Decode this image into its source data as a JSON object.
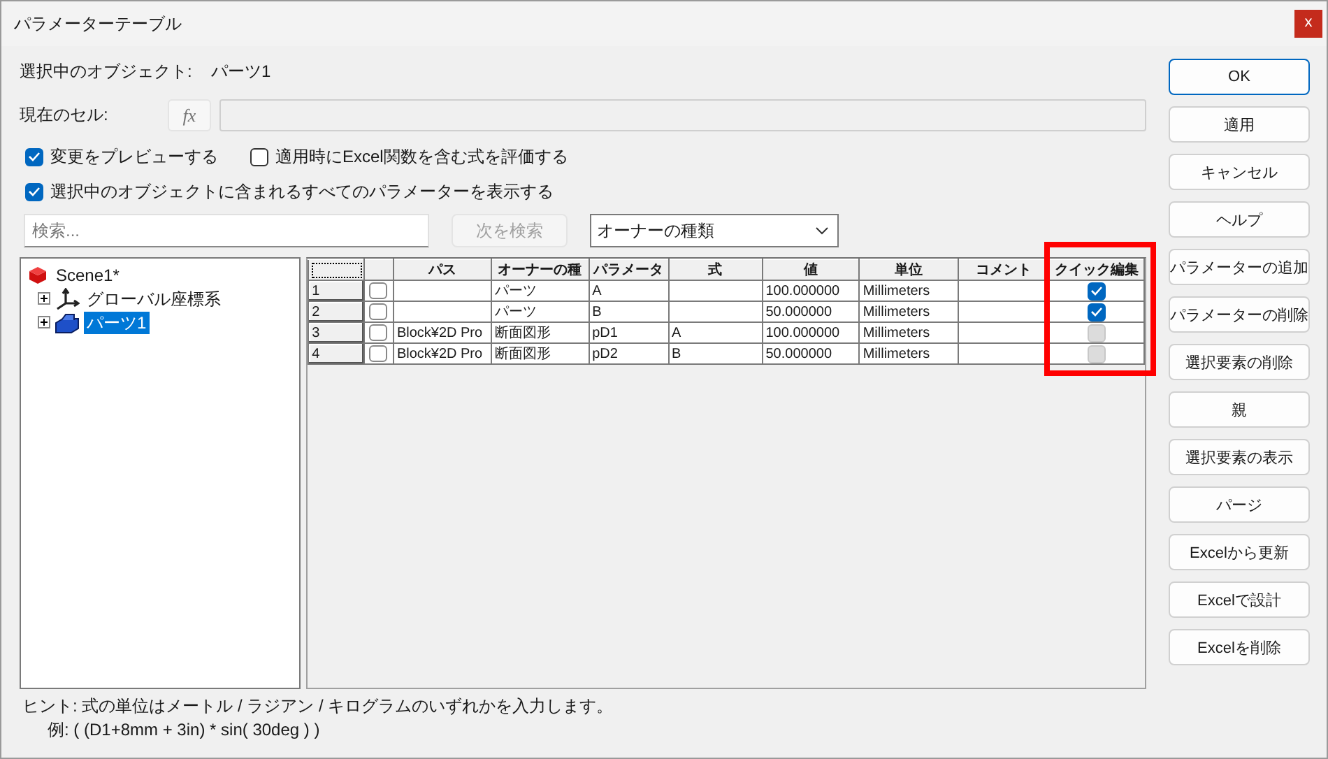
{
  "window": {
    "title": "パラメーターテーブル",
    "close": "x"
  },
  "selected_object": {
    "label": "選択中のオブジェクト:",
    "value": "パーツ1"
  },
  "current_cell": {
    "label": "現在のセル:",
    "fx": "fx"
  },
  "options": [
    {
      "label": "変更をプレビューする",
      "checked": true
    },
    {
      "label": "適用時にExcel関数を含む式を評価する",
      "checked": false
    },
    {
      "label": "選択中のオブジェクトに含まれるすべてのパラメーターを表示する",
      "checked": true
    }
  ],
  "search": {
    "placeholder": "検索...",
    "find_next": {
      "label": "次を検索",
      "disabled": true
    },
    "filter": "オーナーの種類"
  },
  "tree": [
    {
      "label": "Scene1*",
      "kind": "scene",
      "selected": false,
      "children": [
        {
          "label": "グローバル座標系",
          "kind": "axes",
          "selected": false,
          "expanded": false
        },
        {
          "label": "パーツ1",
          "kind": "part",
          "selected": true,
          "expanded": false
        }
      ]
    }
  ],
  "table": {
    "columns": [
      "パス",
      "オーナーの種",
      "パラメータ",
      "式",
      "値",
      "単位",
      "コメント",
      "クイック編集"
    ],
    "rows": [
      {
        "number": "1",
        "checked": false,
        "cells": [
          "",
          "パーツ",
          "A",
          "",
          "100.000000",
          "Millimeters",
          ""
        ],
        "quick_edit": true,
        "quick_edit_disabled": false
      },
      {
        "number": "2",
        "checked": false,
        "cells": [
          "",
          "パーツ",
          "B",
          "",
          "50.000000",
          "Millimeters",
          ""
        ],
        "quick_edit": true,
        "quick_edit_disabled": false
      },
      {
        "number": "3",
        "checked": false,
        "cells": [
          "Block¥2D Pro",
          "断面図形",
          "pD1",
          "A",
          "100.000000",
          "Millimeters",
          ""
        ],
        "quick_edit": false,
        "quick_edit_disabled": true
      },
      {
        "number": "4",
        "checked": false,
        "cells": [
          "Block¥2D Pro",
          "断面図形",
          "pD2",
          "B",
          "50.000000",
          "Millimeters",
          ""
        ],
        "quick_edit": false,
        "quick_edit_disabled": true
      }
    ]
  },
  "hint": [
    "ヒント: 式の単位はメートル / ラジアン / キログラムのいずれかを入力します。",
    "例: ( (D1+8mm + 3in) * sin( 30deg ) )"
  ],
  "buttons": [
    {
      "label": "OK",
      "default": true
    },
    {
      "label": "適用",
      "default": false
    },
    {
      "label": "キャンセル",
      "default": false
    },
    {
      "label": "ヘルプ",
      "default": false
    },
    {
      "label": "パラメーターの追加",
      "default": false
    },
    {
      "label": "パラメーターの削除",
      "default": false
    },
    {
      "label": "選択要素の削除",
      "default": false
    },
    {
      "label": "親",
      "default": false
    },
    {
      "label": "選択要素の表示",
      "default": false
    },
    {
      "label": "パージ",
      "default": false
    },
    {
      "label": "Excelから更新",
      "default": false
    },
    {
      "label": "Excelで設計",
      "default": false
    },
    {
      "label": "Excelを削除",
      "default": false
    }
  ]
}
